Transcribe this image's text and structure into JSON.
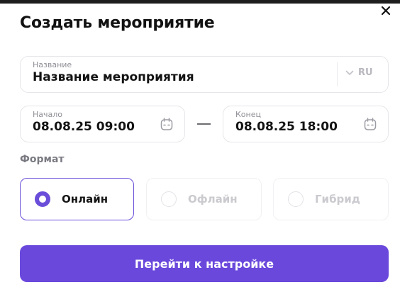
{
  "dialog": {
    "title": "Создать мероприятие",
    "close_icon": "close-icon"
  },
  "name_field": {
    "label": "Название",
    "value": "Название мероприятия",
    "language": "RU",
    "language_icon": "chevron-down-icon"
  },
  "start_field": {
    "label": "Начало",
    "value": "08.08.25 09:00",
    "icon": "calendar-icon"
  },
  "end_field": {
    "label": "Конец",
    "value": "08.08.25 18:00",
    "icon": "calendar-icon"
  },
  "format": {
    "label": "Формат",
    "options": [
      {
        "label": "Онлайн",
        "selected": true
      },
      {
        "label": "Офлайн",
        "selected": false
      },
      {
        "label": "Гибрид",
        "selected": false
      }
    ]
  },
  "actions": {
    "submit_label": "Перейти к настройке"
  },
  "colors": {
    "accent": "#6a48dc",
    "border": "#e6e6ea",
    "muted_text": "#8f8f97"
  }
}
